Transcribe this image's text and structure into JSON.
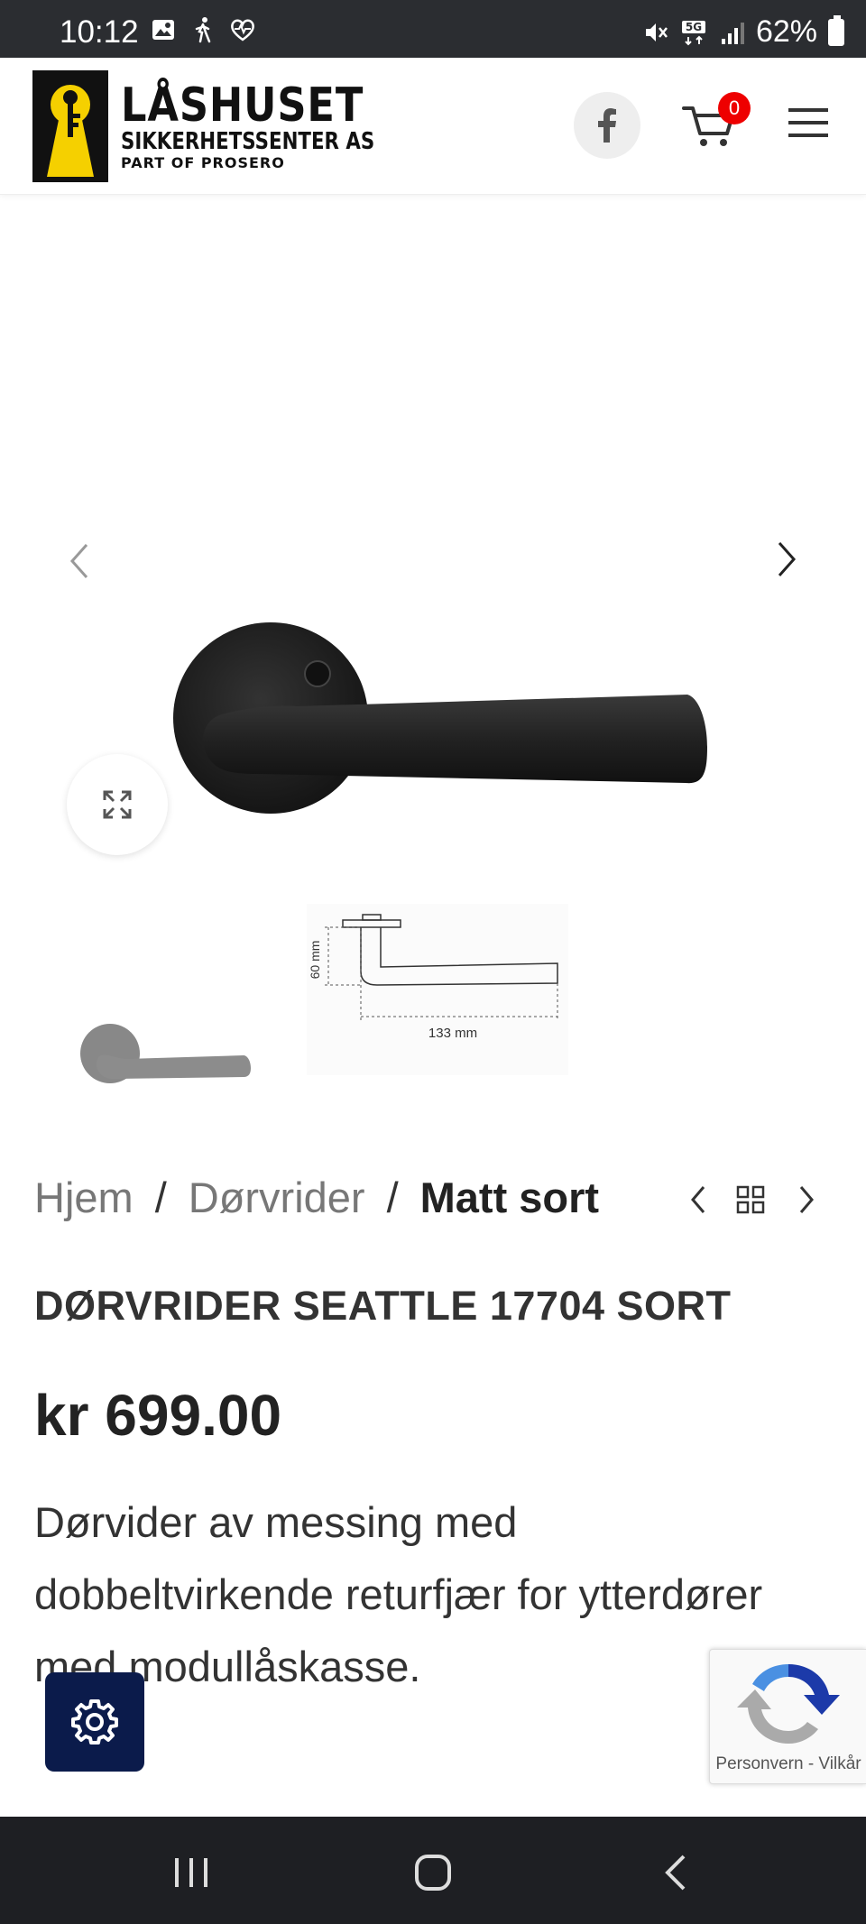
{
  "status_bar": {
    "time": "10:12",
    "battery": "62%",
    "icons_left": [
      "image-icon",
      "walking-icon",
      "heart-rate-icon"
    ],
    "icons_right": [
      "mute-icon",
      "5g-icon",
      "signal-icon",
      "battery-icon"
    ]
  },
  "header": {
    "logo_title": "LÅSHUSET",
    "logo_subtitle": "SIKKERHETSSENTER AS",
    "logo_tagline": "PART OF PROSERO",
    "logo_key_text": "LÅS HUSET",
    "cart_count": "0"
  },
  "gallery": {
    "dimension_height": "60 mm",
    "dimension_width": "133 mm"
  },
  "breadcrumb": {
    "items": [
      "Hjem",
      "Dørvrider"
    ],
    "current": "Matt sort",
    "separator": "/"
  },
  "product": {
    "title": "DØRVRIDER SEATTLE 17704 SORT",
    "price": "kr 699.00",
    "description": "Dørvider av messing med dobbeltvirkende returfjær for ytterdører med modullåskasse."
  },
  "recaptcha": {
    "text": "Personvern - Vilkår"
  },
  "colors": {
    "brand_yellow": "#f5d000",
    "settings_bg": "#0b1b4b",
    "badge_red": "#e00000"
  }
}
